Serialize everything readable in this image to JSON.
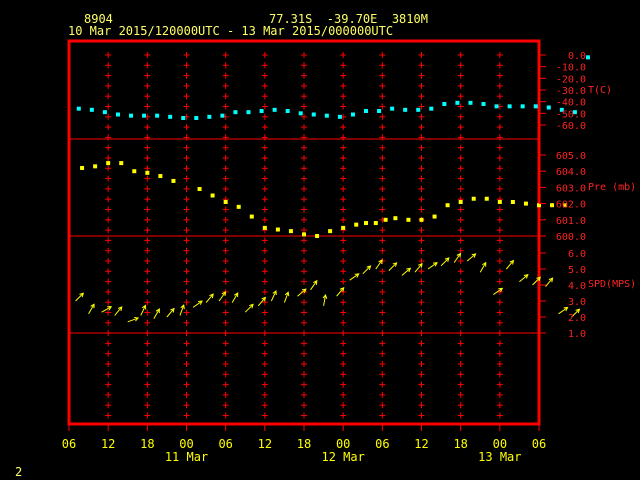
{
  "header": {
    "station_id": "8904",
    "location": "77.31S  -39.70E  3810M",
    "time_range": "10 Mar 2015/120000UTC - 13 Mar 2015/000000UTC"
  },
  "page_number": "2",
  "colors": {
    "frame": "#ff0000",
    "axis_text": "#ffff00",
    "temperature": "#00ffff",
    "pressure": "#ffff00",
    "wind": "#ffff00",
    "right_labels": "#ff2222",
    "background": "#000000"
  },
  "chart_data": [
    {
      "type": "scatter",
      "panel": "temperature",
      "ylabel": "T(C)",
      "yticks": [
        "0.0",
        "-10.0",
        "-20.0",
        "-30.0",
        "-40.0",
        "-50.0",
        "-60.0"
      ],
      "ylim": [
        -60,
        0
      ],
      "x_hours": [
        1.5,
        3.5,
        5.5,
        7.5,
        9.5,
        11.5,
        13.5,
        15.5,
        17.5,
        19.5,
        21.5,
        23.5,
        25.5,
        27.5,
        29.5,
        31.5,
        33.5,
        35.5,
        37.5,
        39.5,
        41.5,
        43.5,
        45.5,
        47.5,
        49.5,
        51.5,
        53.5,
        55.5,
        57.5,
        59.5,
        61.5,
        63.5,
        65.5,
        67.5,
        69.5,
        71.5,
        73.5,
        75.5,
        77.5,
        79.5
      ],
      "values": [
        -46,
        -47,
        -49,
        -51,
        -52,
        -52,
        -52,
        -53,
        -54,
        -54,
        -53,
        -52,
        -49,
        -49,
        -48,
        -47,
        -48,
        -50,
        -51,
        -52,
        -53,
        -51,
        -48,
        -48,
        -46,
        -47,
        -47,
        -46,
        -42,
        -41,
        -41,
        -42,
        -44,
        -44,
        -44,
        -44,
        -45,
        -47,
        -49,
        -2
      ]
    },
    {
      "type": "scatter",
      "panel": "pressure",
      "ylabel": "Pre (mb)",
      "yticks": [
        "605.0",
        "604.0",
        "603.0",
        "602.0",
        "601.0",
        "600.0"
      ],
      "ylim": [
        600,
        605.5
      ],
      "x_hours": [
        2,
        4,
        6,
        8,
        10,
        12,
        14,
        16,
        20,
        22,
        24,
        26,
        28,
        30,
        32,
        34,
        36,
        38,
        40,
        42,
        44,
        45.5,
        47,
        48.5,
        50,
        52,
        54,
        56,
        58,
        60,
        62,
        64,
        66,
        68,
        70,
        72,
        74,
        76
      ],
      "values": [
        604.2,
        604.3,
        604.5,
        604.5,
        604.0,
        603.9,
        603.7,
        603.4,
        602.9,
        602.5,
        602.1,
        601.8,
        601.2,
        600.5,
        600.4,
        600.3,
        600.1,
        600.0,
        600.3,
        600.5,
        600.7,
        600.8,
        600.8,
        601.0,
        601.1,
        601.0,
        601.0,
        601.2,
        601.9,
        602.1,
        602.3,
        602.3,
        602.1,
        602.1,
        602.0,
        601.9,
        601.9,
        601.9
      ]
    },
    {
      "type": "wind_vectors",
      "panel": "wind",
      "ylabel": "SPD(MPS)",
      "yticks": [
        "6.0",
        "5.0",
        "4.0",
        "3.0",
        "2.0",
        "1.0"
      ],
      "ylim": [
        1,
        6.5
      ],
      "x_hours": [
        1,
        3,
        5,
        7,
        9,
        11,
        13,
        15,
        17,
        19,
        21,
        23,
        25,
        27,
        29,
        31,
        33,
        35,
        37,
        39,
        41,
        43,
        45,
        47,
        49,
        51,
        53,
        55,
        57,
        59,
        61,
        63,
        65,
        67,
        69,
        71,
        73,
        75,
        77
      ],
      "speed": [
        3.0,
        2.2,
        2.3,
        2.1,
        1.7,
        2.1,
        1.9,
        2.0,
        2.1,
        2.6,
        2.9,
        3.0,
        2.9,
        2.3,
        2.7,
        3.0,
        2.9,
        3.3,
        3.7,
        2.7,
        3.3,
        4.3,
        4.7,
        5.0,
        4.9,
        4.6,
        4.8,
        5.0,
        5.2,
        5.4,
        5.5,
        4.8,
        3.4,
        5.0,
        4.2,
        4.0,
        3.9,
        2.2,
        2.0
      ],
      "direction_deg": [
        225,
        240,
        210,
        230,
        200,
        245,
        240,
        230,
        250,
        215,
        230,
        235,
        240,
        225,
        230,
        245,
        250,
        220,
        235,
        260,
        230,
        215,
        225,
        235,
        225,
        220,
        230,
        215,
        225,
        235,
        220,
        240,
        215,
        230,
        220,
        225,
        230,
        215,
        225
      ]
    }
  ],
  "x_axis": {
    "tick_labels": [
      "06",
      "12",
      "18",
      "00",
      "06",
      "12",
      "18",
      "00",
      "06",
      "12",
      "18",
      "00",
      "06"
    ],
    "date_labels": [
      "11 Mar",
      "12 Mar",
      "13 Mar"
    ],
    "start": "10 Mar 2015 06UTC",
    "interval_hours": 6
  }
}
